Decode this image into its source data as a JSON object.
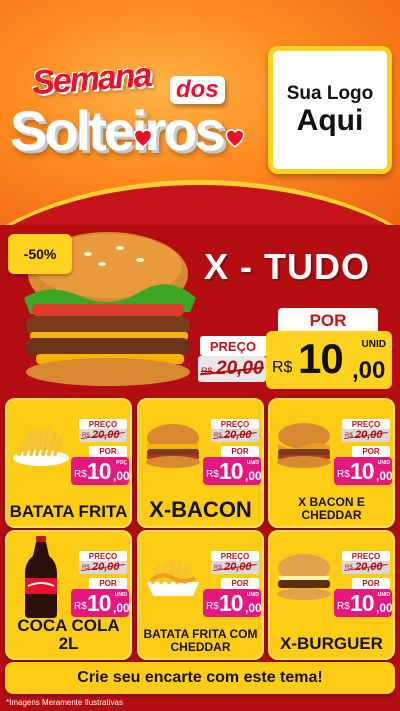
{
  "header": {
    "brand": {
      "line1": "Semana",
      "dos": "dos",
      "line2": "Solteiros"
    },
    "logo": {
      "line1": "Sua Logo",
      "line2": "Aqui"
    }
  },
  "hero": {
    "discount": "-50%",
    "title": "X - TUDO",
    "preco_label": "PREÇO",
    "old_currency": "R$",
    "old_value": "20,00",
    "por_label": "POR",
    "currency": "R$",
    "price_int": "10",
    "price_dec": ",00",
    "unit": "UNID"
  },
  "products": [
    {
      "name": "BATATA FRITA",
      "preco_label": "PREÇO",
      "old_currency": "R$",
      "old_value": "20,00",
      "por_label": "POR",
      "currency": "R$",
      "price_int": "10",
      "price_dec": ",00",
      "unit": "POÇ"
    },
    {
      "name": "X-BACON",
      "preco_label": "PREÇO",
      "old_currency": "R$",
      "old_value": "20,00",
      "por_label": "POR",
      "currency": "R$",
      "price_int": "10",
      "price_dec": ",00",
      "unit": "UNID"
    },
    {
      "name": "X BACON E CHEDDAR",
      "preco_label": "PREÇO",
      "old_currency": "R$",
      "old_value": "20,00",
      "por_label": "POR",
      "currency": "R$",
      "price_int": "10",
      "price_dec": ",00",
      "unit": "UNID"
    },
    {
      "name": "COCA COLA 2L",
      "preco_label": "PREÇO",
      "old_currency": "R$",
      "old_value": "20,00",
      "por_label": "POR",
      "currency": "R$",
      "price_int": "10",
      "price_dec": ",00",
      "unit": "UNID"
    },
    {
      "name": "BATATA FRITA COM CHEDDAR",
      "preco_label": "PREÇO",
      "old_currency": "R$",
      "old_value": "20,00",
      "por_label": "POR",
      "currency": "R$",
      "price_int": "10",
      "price_dec": ",00",
      "unit": "UNID"
    },
    {
      "name": "X-BURGUER",
      "preco_label": "PREÇO",
      "old_currency": "R$",
      "old_value": "20,00",
      "por_label": "POR",
      "currency": "R$",
      "price_int": "10",
      "price_dec": ",00",
      "unit": "UNID"
    }
  ],
  "footer": {
    "cta": "Crie seu encarte com este tema!",
    "disclaimer": "*Imagens Meramente Ilustrativas"
  },
  "colors": {
    "background_red": "#b30d12",
    "accent_yellow": "#ffcc15",
    "price_pink": "#e6177e",
    "header_orange": "#ff8a1e"
  }
}
